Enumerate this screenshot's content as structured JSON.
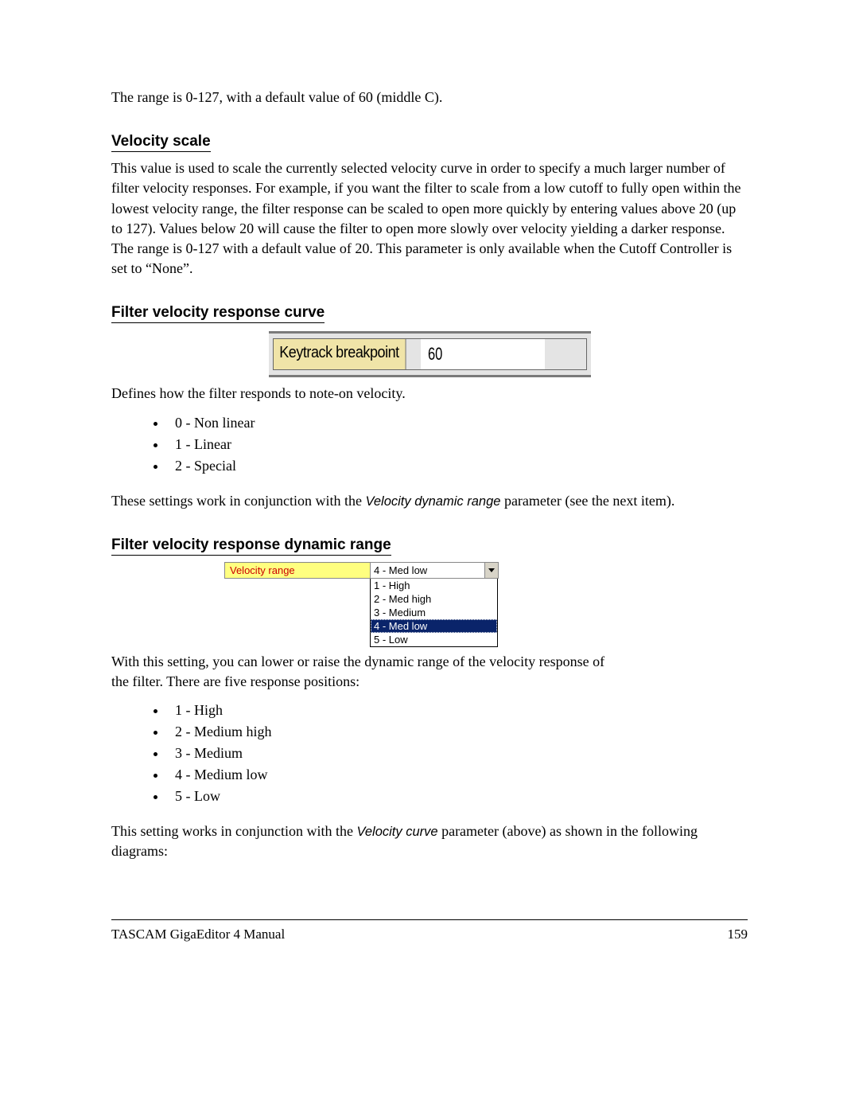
{
  "intro": "The range is 0-127, with a default value of 60 (middle C).",
  "velocity_scale": {
    "heading": "Velocity scale",
    "text": "This value is used to scale the currently selected velocity curve in order to specify a much larger number of filter velocity responses.  For example, if you want the filter to scale from a low cutoff to fully open within the lowest velocity range, the filter response can be scaled to open more quickly by entering values above 20 (up to 127). Values below 20 will cause the filter to open more slowly over velocity yielding a darker response. The range is 0-127 with a default value of 20.  This parameter is only available when the Cutoff Controller is set to “None”."
  },
  "fvrc": {
    "heading": "Filter velocity response curve",
    "ui_label": "Keytrack breakpoint",
    "ui_value": "60",
    "caption": "Defines how the filter responds to note-on velocity.",
    "items": [
      "0 - Non linear",
      "1 - Linear",
      "2 - Special"
    ],
    "outro_pre": "These settings work in conjunction with the ",
    "outro_em": "Velocity dynamic range",
    "outro_post": " parameter (see the next item)."
  },
  "fvrdr": {
    "heading": "Filter velocity response dynamic range",
    "ui_label": "Velocity range",
    "selected": "4 - Med low",
    "options": [
      "1 - High",
      "2 - Med high",
      "3 - Medium",
      "4 - Med low",
      "5 - Low"
    ],
    "caption": "With this setting, you can lower or raise the dynamic range of the velocity response of the filter.  There are five response positions:",
    "items": [
      "1 - High",
      "2 - Medium high",
      "3 - Medium",
      "4 - Medium low",
      "5 - Low"
    ],
    "outro_pre": "This setting works in conjunction with the ",
    "outro_em": "Velocity curve",
    "outro_post": " parameter (above) as shown in the following diagrams:"
  },
  "footer": {
    "left": "TASCAM GigaEditor 4 Manual",
    "right": "159"
  }
}
